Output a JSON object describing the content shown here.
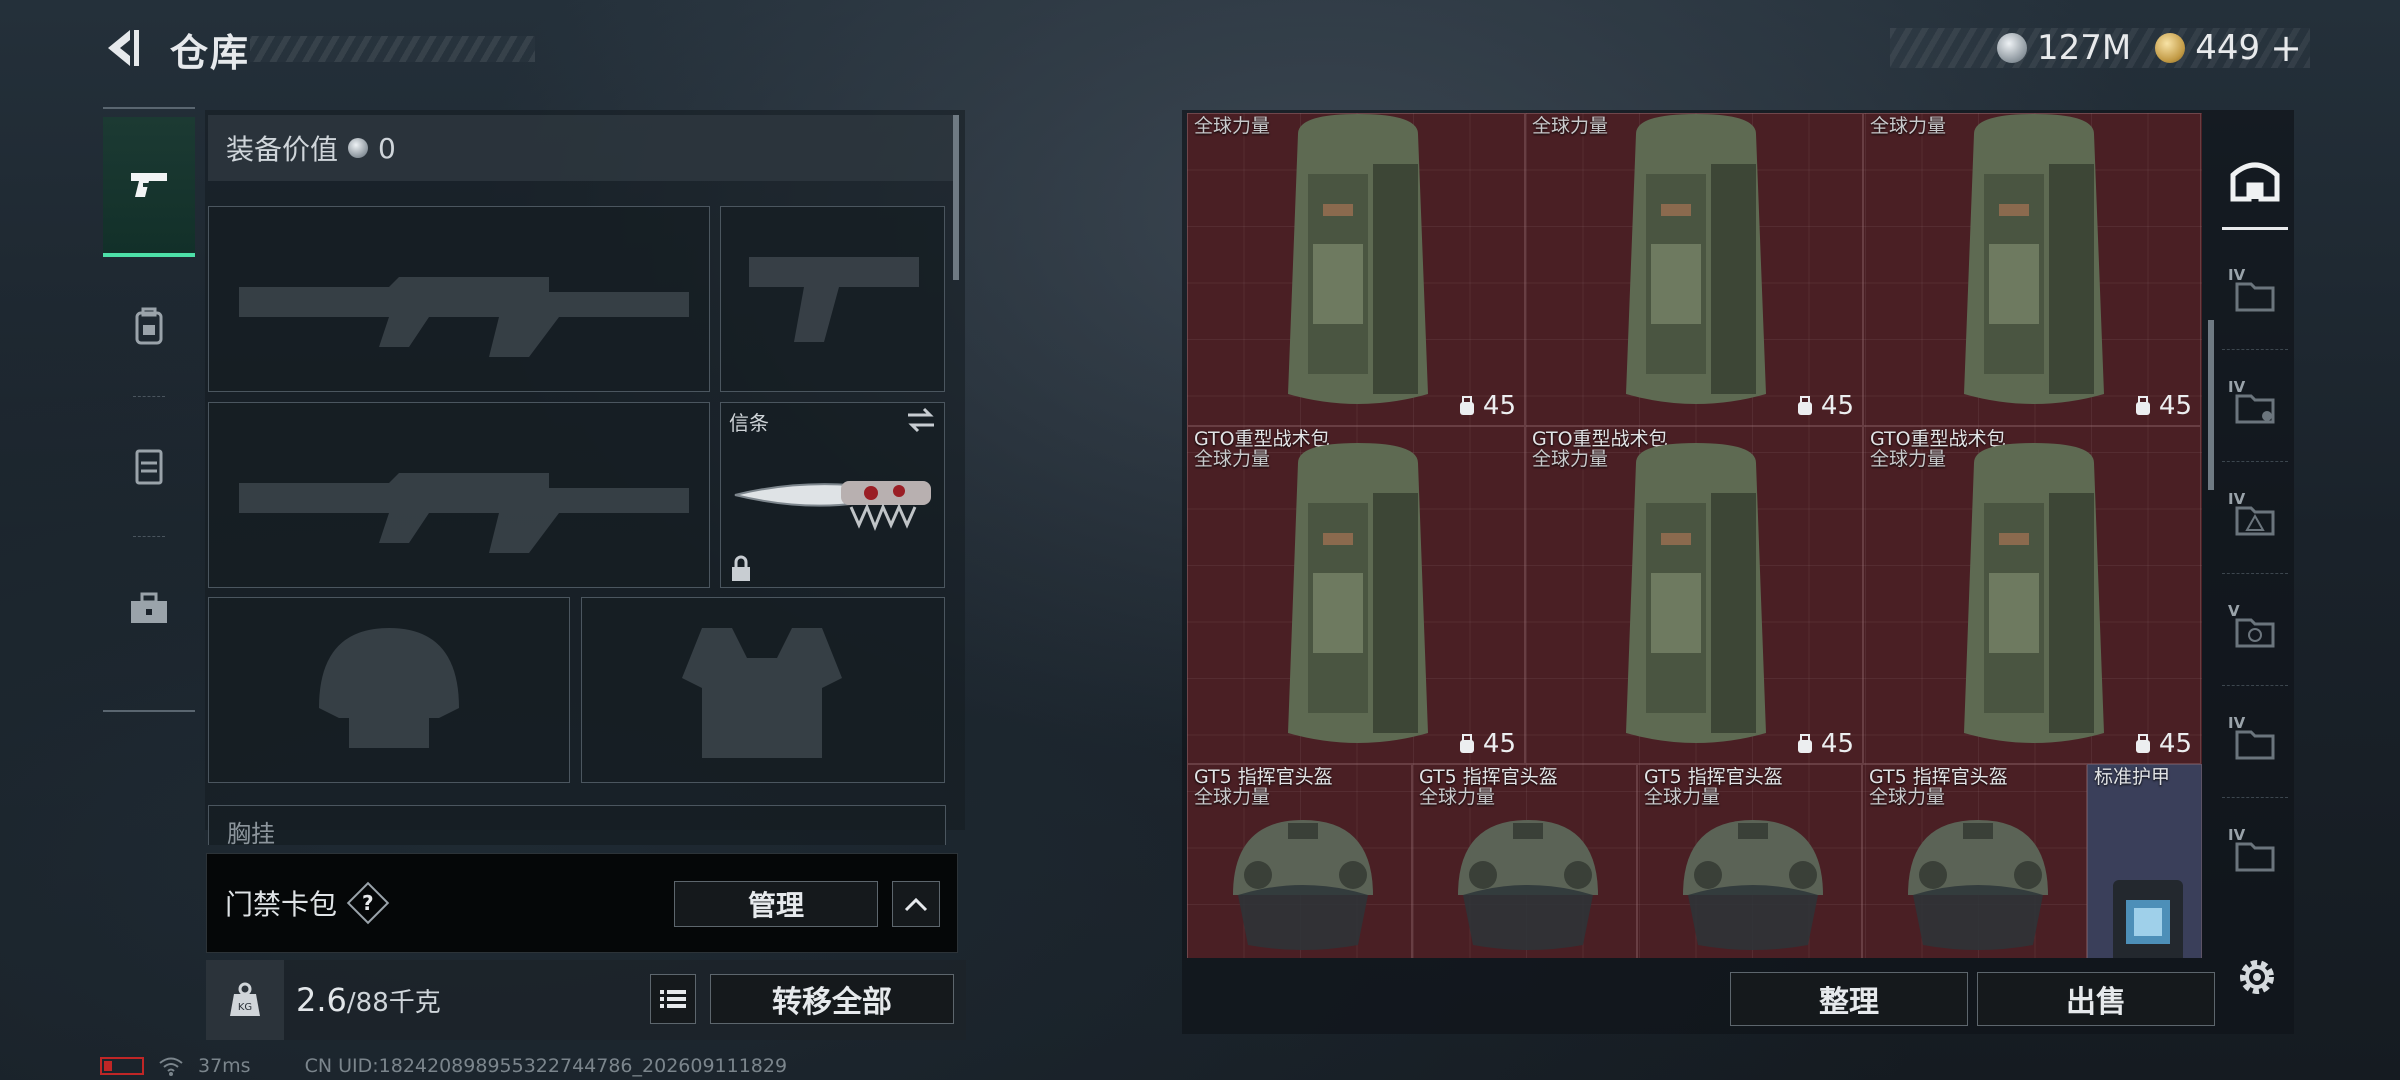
{
  "header": {
    "title": "仓库",
    "currencies": [
      {
        "type": "silver",
        "amount": "127M"
      },
      {
        "type": "gold",
        "amount": "449"
      }
    ],
    "gold_plus": "+"
  },
  "left_rail": {
    "items": [
      {
        "icon": "pistol-icon",
        "active": true
      },
      {
        "icon": "backpack-icon",
        "active": false
      },
      {
        "icon": "vest-icon",
        "active": false
      },
      {
        "icon": "toolbox-icon",
        "active": false
      }
    ]
  },
  "loadout": {
    "value_label": "装备价值",
    "value_amount": "0",
    "melee_label": "信条",
    "chest_label": "胸挂",
    "access_card_label": "门禁卡包",
    "help_symbol": "?",
    "manage_label": "管理",
    "weight_current": "2.6",
    "weight_capacity": "/88千克",
    "transfer_all_label": "转移全部"
  },
  "status": {
    "ping": "37ms",
    "uid": "CN UID:18242089895532274478​6_202609111829"
  },
  "stash": {
    "backpacks": [
      {
        "name": "",
        "owner": "全球力量",
        "capacity": "45"
      },
      {
        "name": "",
        "owner": "全球力量",
        "capacity": "45"
      },
      {
        "name": "",
        "owner": "全球力量",
        "capacity": "45"
      },
      {
        "name": "GTO重型战术包",
        "owner": "全球力量",
        "capacity": "45"
      },
      {
        "name": "GTO重型战术包",
        "owner": "全球力量",
        "capacity": "45"
      },
      {
        "name": "GTO重型战术包",
        "owner": "全球力量",
        "capacity": "45"
      }
    ],
    "helmets": [
      {
        "name": "GT5 指挥官头盔",
        "owner": "全球力量"
      },
      {
        "name": "GT5 指挥官头盔",
        "owner": "全球力量"
      },
      {
        "name": "GT5 指挥官头盔",
        "owner": "全球力量"
      },
      {
        "name": "GT5 指挥官头盔",
        "owner": "全球力量"
      }
    ],
    "armor": {
      "name": "标准护甲"
    },
    "sort_label": "整理",
    "sell_label": "出售"
  },
  "right_tabs": {
    "levels": [
      "IV",
      "IV",
      "IV",
      "V",
      "IV",
      "IV"
    ]
  },
  "colors": {
    "stash_bg": "#4a1f24",
    "active_accent": "#4de0a8",
    "armor_bg": "#3a3f5a"
  }
}
